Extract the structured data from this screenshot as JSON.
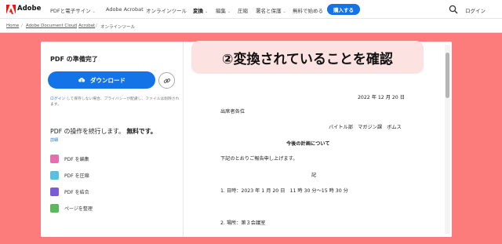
{
  "topnav": {
    "brand": "Adobe",
    "items": [
      {
        "label": "PDFと電子サイン",
        "has_caret": true,
        "active": false
      },
      {
        "label": "Adobe Acrobat",
        "has_caret": false,
        "active": false
      },
      {
        "label": "オンラインツール",
        "has_caret": false,
        "active": false
      },
      {
        "label": "変換",
        "has_caret": true,
        "active": true
      },
      {
        "label": "編集",
        "has_caret": true,
        "active": false
      },
      {
        "label": "圧縮",
        "has_caret": false,
        "active": false
      },
      {
        "label": "署名と保護",
        "has_caret": true,
        "active": false
      },
      {
        "label": "無料で始める",
        "has_caret": false,
        "active": false
      }
    ],
    "buy_label": "購入する",
    "login_label": "ログイン",
    "caret_glyph": "⌄"
  },
  "breadcrumb": [
    "Home",
    "Adobe Document Cloud",
    "Acrobat",
    "オンラインツール"
  ],
  "left_panel": {
    "status": "PDF の準備完了",
    "download_label": "ダウンロード",
    "signin_note_link": "ログイン",
    "signin_note_rest": " して保存しない場合、プライバシーが配慮し、ファイルは削除されます。",
    "continue_text": "PDF の操作を続行します。",
    "continue_free": "無料です。",
    "details_label": "詳細",
    "tools": [
      {
        "label": "PDF を編集",
        "icon": "edit-pdf-icon",
        "color": "#e66fb0"
      },
      {
        "label": "PDF を圧縮",
        "icon": "compress-pdf-icon",
        "color": "#5bc0de"
      },
      {
        "label": "PDF を結合",
        "icon": "merge-pdf-icon",
        "color": "#7b5cd6"
      },
      {
        "label": "ページを整理",
        "icon": "organize-pages-icon",
        "color": "#5cb85c"
      }
    ]
  },
  "document": {
    "date": "2022 年 12 月 20 日",
    "to": "出席者各位",
    "from": "バイトル部　マガジン課　ボムス",
    "title": "今後の計画について",
    "intro": "下記のとおりご報告申し上げます。",
    "ki": "記",
    "item1": "1. 日時：2023 年 1 月 20 日　11 時 30 分～15 時 30 分",
    "item2": "2. 場所：第３会議室"
  },
  "banner": "②変換されていることを確認",
  "colors": {
    "background": "#fc7c7c",
    "accent": "#1473e6",
    "banner_bg": "#fde2e2"
  }
}
